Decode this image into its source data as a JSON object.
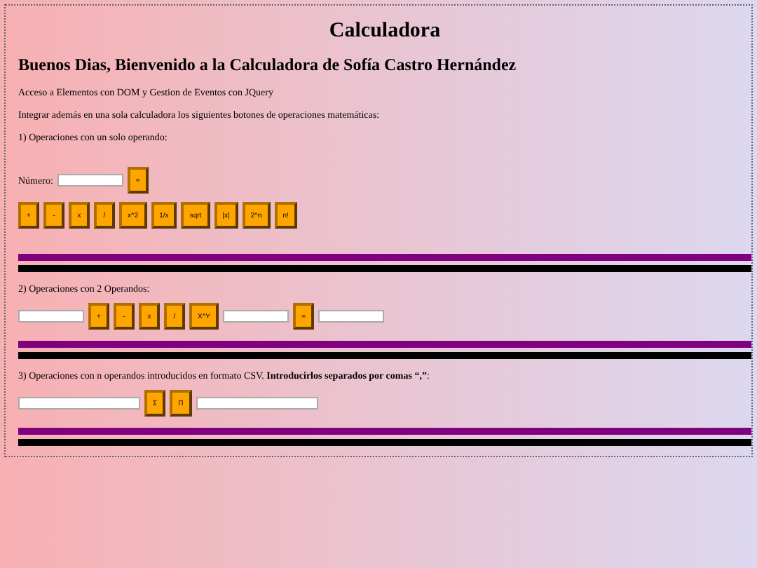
{
  "title": "Calculadora",
  "heading": "Buenos Dias, Bienvenido a la Calculadora de Sofía Castro Hernández",
  "paragraphs": [
    "Acceso a Elementos con DOM y Gestion de Eventos con JQuery",
    "Integrar además en una sola calculadora los siguientes botones de operaciones matemáticas:"
  ],
  "section1": {
    "label": "1) Operaciones con un solo operando:",
    "field_label": "Número:",
    "equals": "=",
    "buttons": [
      "+",
      "-",
      "x",
      "/",
      "x^2",
      "1/x",
      "sqrt",
      "|x|",
      "2^n",
      "n!"
    ]
  },
  "section2": {
    "label": "2) Operaciones con 2 Operandos:",
    "buttons": [
      "+",
      "-",
      "x",
      "/",
      "X^Y"
    ],
    "equals": "="
  },
  "section3": {
    "label": "3) Operaciones con n operandos introducidos en formato CSV. **Introducirlos separados por comas “,”**:",
    "buttons": [
      "Σ",
      "Π"
    ]
  }
}
